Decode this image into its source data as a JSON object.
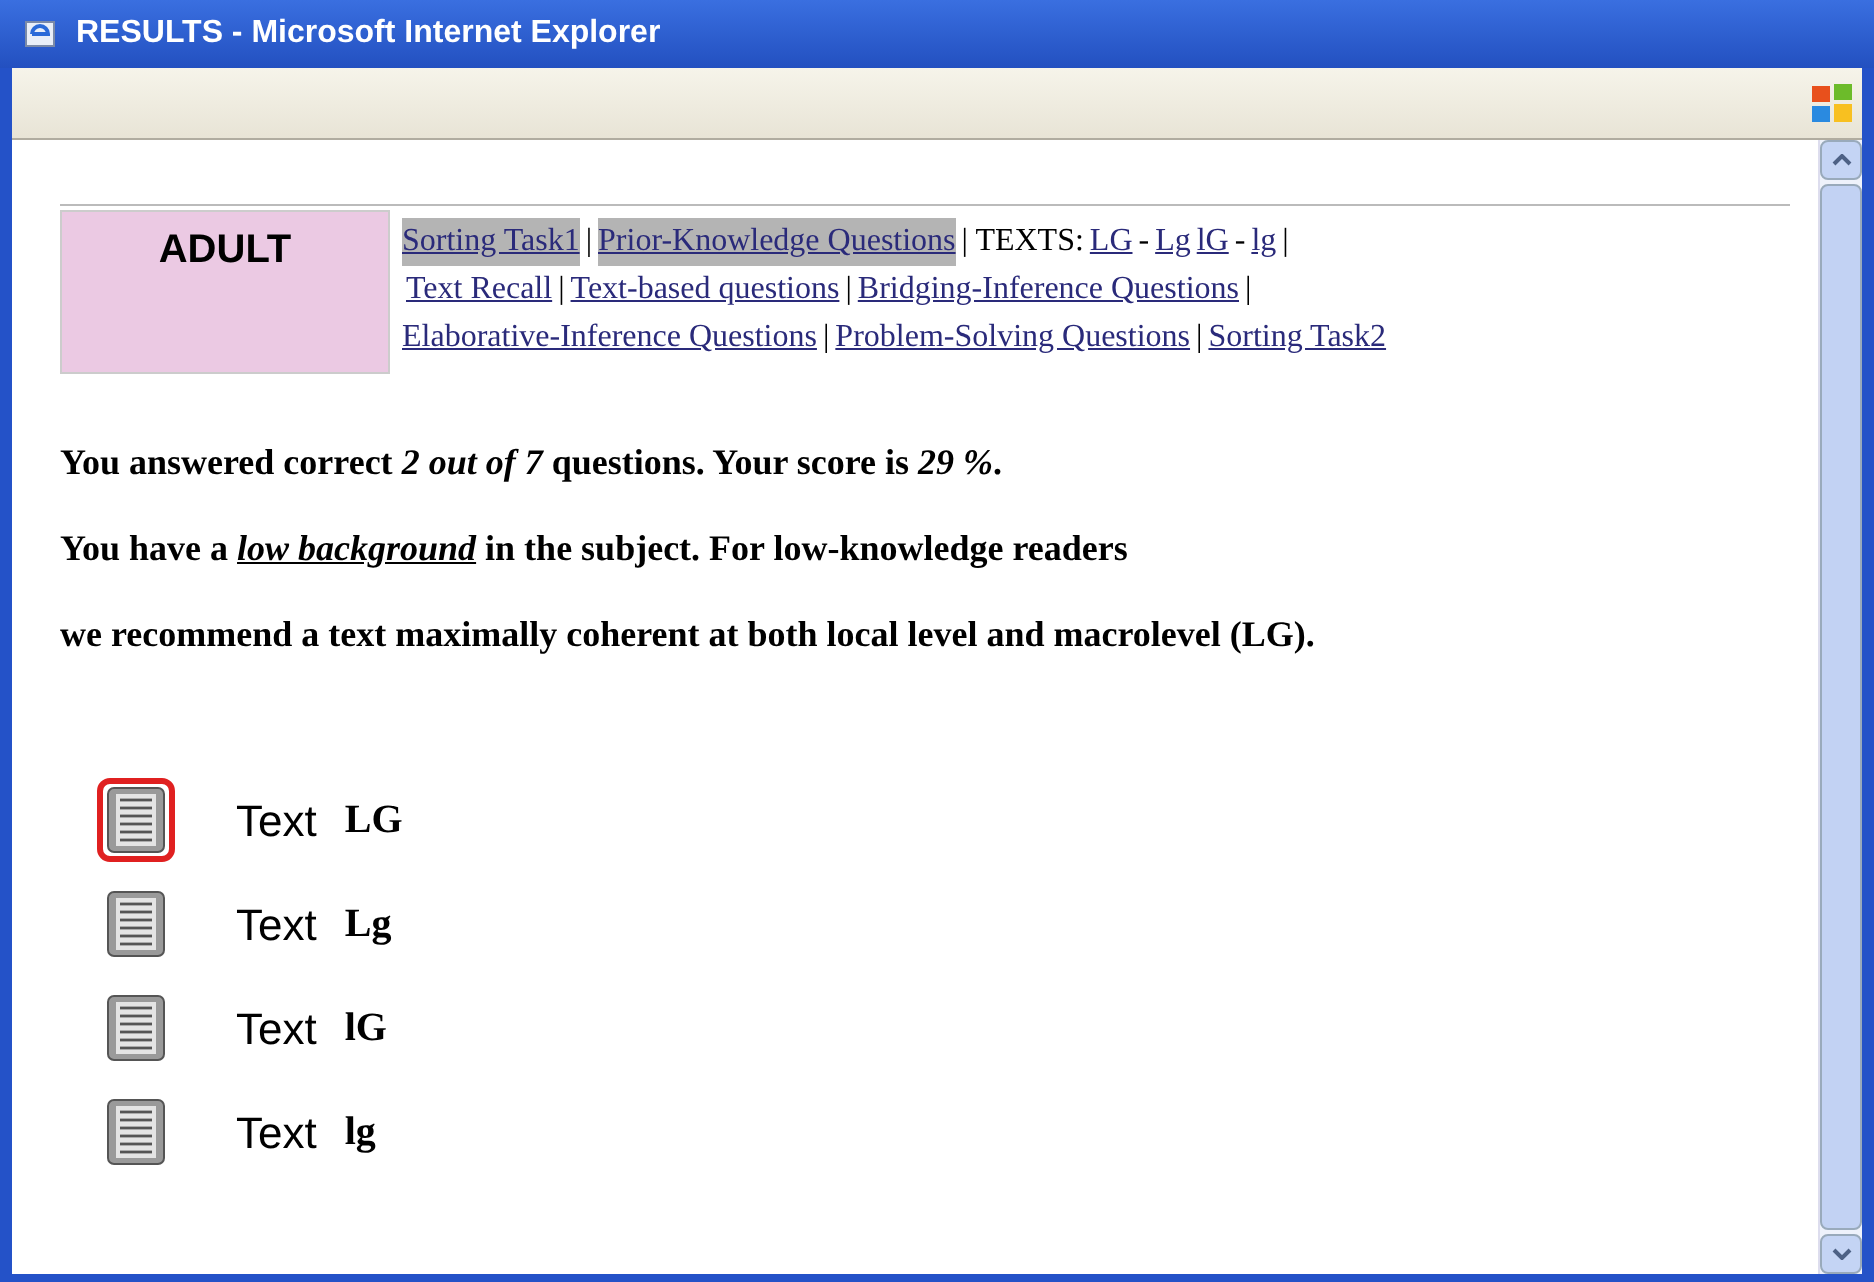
{
  "window": {
    "title": "RESULTS - Microsoft Internet Explorer"
  },
  "badge": {
    "label": "ADULT"
  },
  "nav": [
    [
      {
        "kind": "link",
        "text": "Sorting Task1",
        "highlighted": true
      },
      {
        "kind": "separator",
        "text": "|"
      },
      {
        "kind": "link",
        "text": "Prior-Knowledge Questions",
        "highlighted": true
      },
      {
        "kind": "separator",
        "text": "| TEXTS:"
      },
      {
        "kind": "link",
        "text": "LG",
        "highlighted": false
      },
      {
        "kind": "separator",
        "text": "-"
      },
      {
        "kind": "link",
        "text": "Lg",
        "highlighted": false
      },
      {
        "kind": "link",
        "text": "lG",
        "highlighted": false
      },
      {
        "kind": "separator",
        "text": "-"
      },
      {
        "kind": "link",
        "text": "lg",
        "highlighted": false
      },
      {
        "kind": "separator",
        "text": "|"
      }
    ],
    [
      {
        "kind": "link",
        "text": "Text Recall",
        "highlighted": false
      },
      {
        "kind": "separator",
        "text": "|"
      },
      {
        "kind": "link",
        "text": "Text-based questions",
        "highlighted": false
      },
      {
        "kind": "separator",
        "text": "|"
      },
      {
        "kind": "link",
        "text": "Bridging-Inference Questions",
        "highlighted": false
      },
      {
        "kind": "separator",
        "text": "|"
      }
    ],
    [
      {
        "kind": "link",
        "text": "Elaborative-Inference Questions",
        "highlighted": false
      },
      {
        "kind": "separator",
        "text": "|"
      },
      {
        "kind": "link",
        "text": "Problem-Solving Questions",
        "highlighted": false
      },
      {
        "kind": "separator",
        "text": "|"
      },
      {
        "kind": "link",
        "text": "Sorting Task2",
        "highlighted": false
      }
    ]
  ],
  "paragraphs": [
    {
      "text": "You answered correct *2 out of 7* questions. Your score is *29 %*.",
      "underline_emphasis": false
    },
    {
      "text": "You have a *low background* in the subject. For low-knowledge readers",
      "underline_emphasis": true
    },
    {
      "text": "we recommend a text maximally coherent at both local level and macrolevel (LG)."
    }
  ],
  "texts": [
    {
      "label": "Text",
      "code": "LG",
      "selected": true
    },
    {
      "label": "Text",
      "code": "Lg",
      "selected": false
    },
    {
      "label": "Text",
      "code": "lG",
      "selected": false
    },
    {
      "label": "Text",
      "code": "lg",
      "selected": false
    }
  ]
}
